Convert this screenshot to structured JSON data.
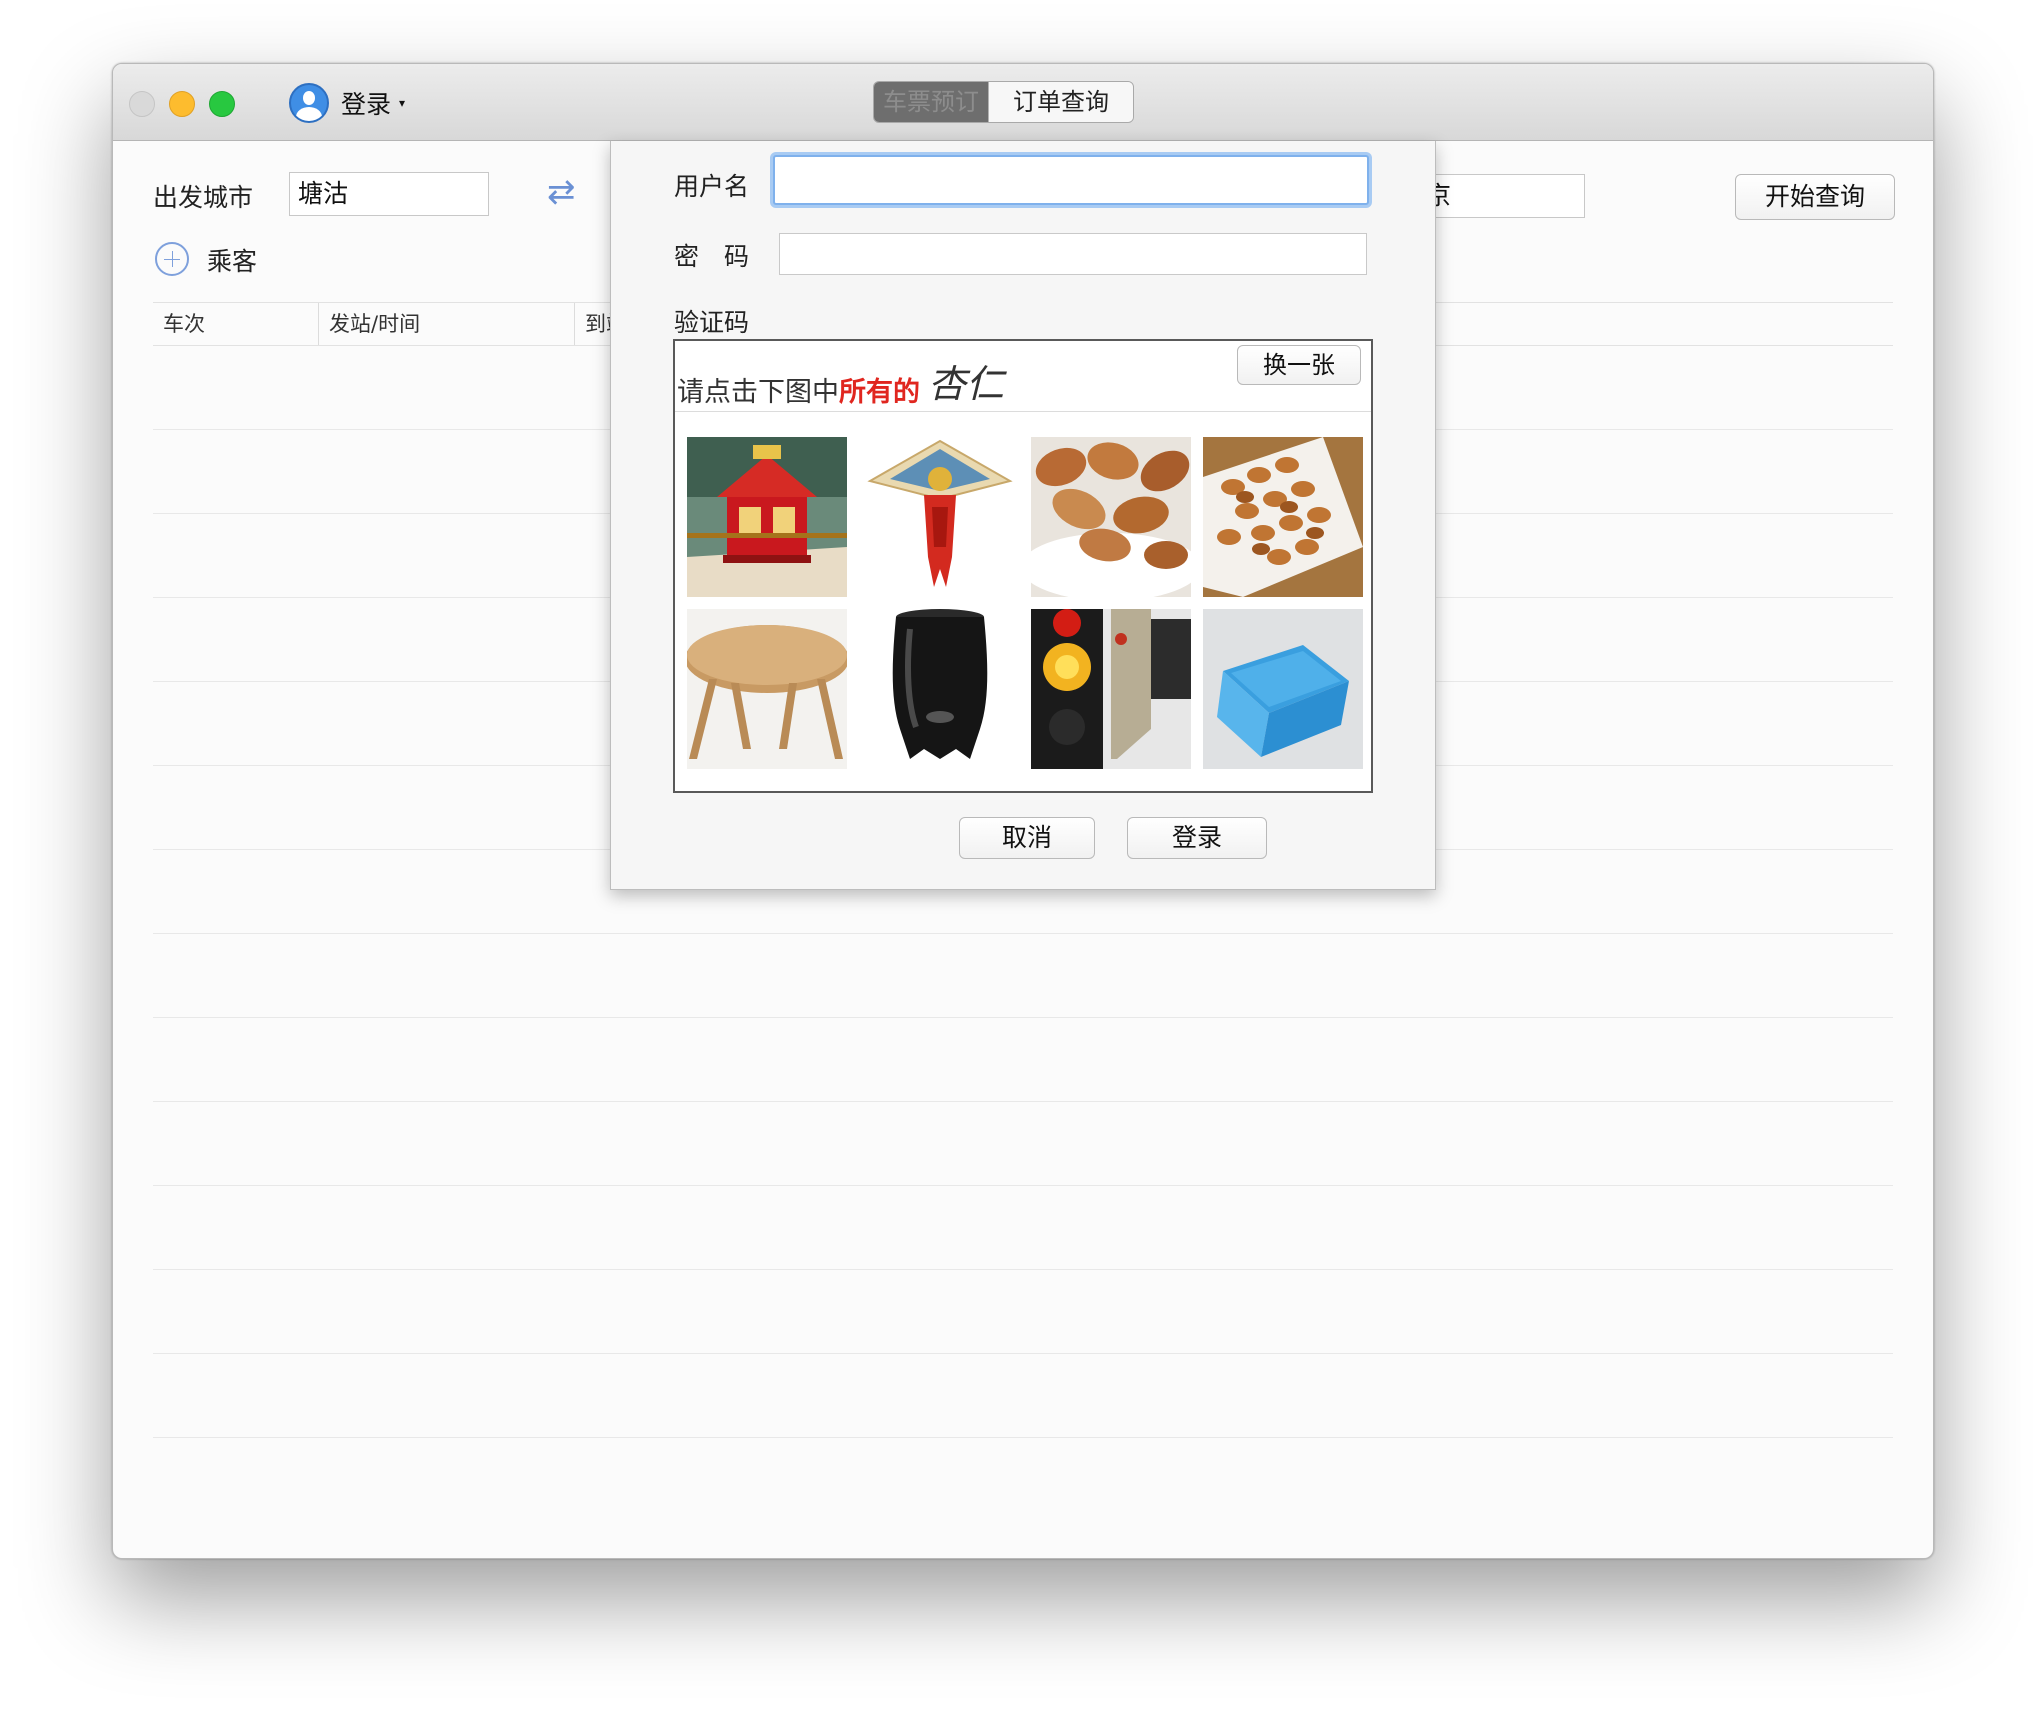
{
  "titlebar": {
    "login_label": "登录",
    "caret": "▾",
    "tabs": [
      {
        "label": "车票预订",
        "active": true
      },
      {
        "label": "订单查询",
        "active": false
      }
    ]
  },
  "search": {
    "from_label": "出发城市",
    "from_value": "塘沽",
    "swap_icon": "⇄",
    "to_value_partial": "京",
    "search_button": "开始查询",
    "passenger_label": "乘客"
  },
  "table": {
    "columns": [
      "车次",
      "发站/时间",
      "到站"
    ],
    "rows": []
  },
  "dialog": {
    "username_label": "用户名",
    "username_value": "",
    "password_label": "密　码",
    "password_value": "",
    "captcha_label": "验证码",
    "captcha": {
      "prompt_prefix": "请点击下图中",
      "prompt_emphasis": "所有的",
      "target_word": "杏仁",
      "refresh_button": "换一张",
      "tiles": [
        "sedan-chair",
        "kite",
        "almonds",
        "almonds-plate",
        "table",
        "vase",
        "traffic-light",
        "paper-box"
      ]
    },
    "cancel_button": "取消",
    "login_button": "登录"
  },
  "colors": {
    "accent": "#3f8ee5",
    "focus_ring": "#a8cbf3",
    "emphasis": "#e0261f"
  }
}
